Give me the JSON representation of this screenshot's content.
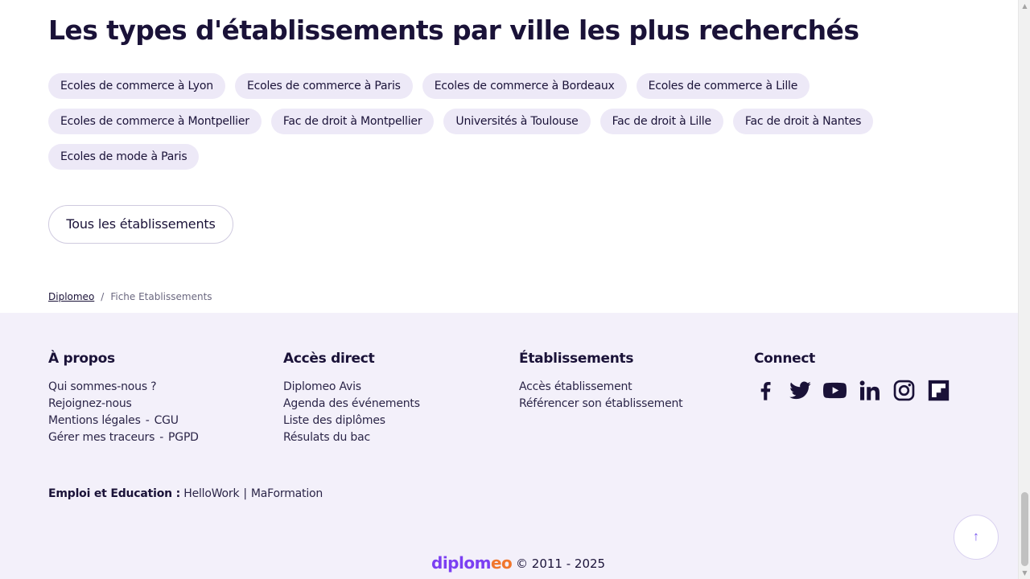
{
  "section": {
    "title": "Les types d'établissements par ville les plus recherchés",
    "chip_rows": [
      [
        "Ecoles de commerce à Lyon",
        "Ecoles de commerce à Paris",
        "Ecoles de commerce à Bordeaux",
        "Ecoles de commerce à Lille"
      ],
      [
        "Ecoles de commerce à Montpellier",
        "Fac de droit à Montpellier",
        "Universités à Toulouse",
        "Fac de droit à Lille",
        "Fac de droit à Nantes"
      ],
      [
        "Ecoles de mode à Paris"
      ]
    ],
    "all_button": "Tous les établissements"
  },
  "breadcrumb": {
    "home": "Diplomeo",
    "separator": "/",
    "current": "Fiche Etablissements"
  },
  "footer": {
    "apropos": {
      "title": "À propos",
      "qui": "Qui sommes-nous ?",
      "rejoignez": "Rejoignez-nous",
      "mentions": "Mentions légales",
      "cgu": "CGU",
      "traceurs": "Gérer mes traceurs",
      "pgpd": "PGPD",
      "dash": "-"
    },
    "acces": {
      "title": "Accès direct",
      "links": [
        "Diplomeo Avis",
        "Agenda des événements",
        "Liste des diplômes",
        "Résulats du bac"
      ]
    },
    "etablissements": {
      "title": "Établissements",
      "links": [
        "Accès établissement",
        "Référencer son établissement"
      ]
    },
    "connect": {
      "title": "Connect",
      "icons": [
        "facebook-icon",
        "twitter-icon",
        "youtube-icon",
        "linkedin-icon",
        "instagram-icon",
        "flipboard-icon"
      ]
    },
    "emploi": {
      "label": "Emploi et Education :",
      "links": [
        "HelloWork",
        "MaFormation"
      ],
      "pipe": "|"
    },
    "copyright": {
      "logo_part1": "diplom",
      "logo_part2": "eo",
      "text": "© 2011 - 2025"
    },
    "back_to_top": "↑"
  },
  "colors": {
    "title": "#1a1238",
    "chip_bg": "#ede9f7",
    "footer_bg": "#f3f0fa",
    "logo_purple": "#7b3ff2",
    "logo_orange": "#f0762d",
    "accent": "#7b5cf0"
  }
}
